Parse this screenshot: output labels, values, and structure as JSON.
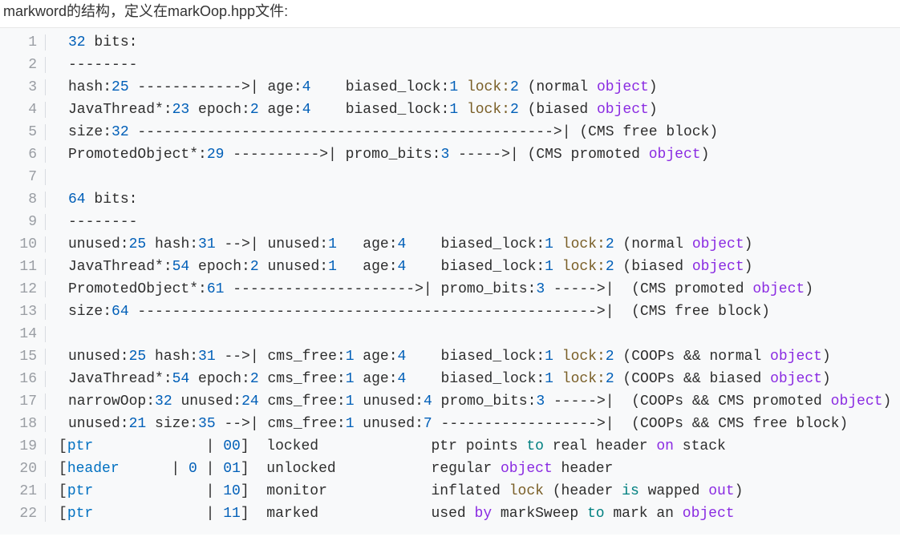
{
  "heading": "markword的结构，定义在markOop.hpp文件:",
  "lines": [
    {
      "n": 1,
      "tokens": [
        [
          "num",
          "32"
        ],
        [
          "plain",
          " bits:"
        ]
      ]
    },
    {
      "n": 2,
      "tokens": [
        [
          "plain",
          "--------"
        ]
      ]
    },
    {
      "n": 3,
      "tokens": [
        [
          "plain",
          "hash:"
        ],
        [
          "num",
          "25"
        ],
        [
          "plain",
          " ------------>| age:"
        ],
        [
          "num",
          "4"
        ],
        [
          "plain",
          "    biased_lock:"
        ],
        [
          "num",
          "1"
        ],
        [
          "plain",
          " "
        ],
        [
          "fn",
          "lock:"
        ],
        [
          "num",
          "2"
        ],
        [
          "plain",
          " (normal "
        ],
        [
          "kw",
          "object"
        ],
        [
          "plain",
          ")"
        ]
      ]
    },
    {
      "n": 4,
      "tokens": [
        [
          "plain",
          "JavaThread*:"
        ],
        [
          "num",
          "23"
        ],
        [
          "plain",
          " epoch:"
        ],
        [
          "num",
          "2"
        ],
        [
          "plain",
          " age:"
        ],
        [
          "num",
          "4"
        ],
        [
          "plain",
          "    biased_lock:"
        ],
        [
          "num",
          "1"
        ],
        [
          "plain",
          " "
        ],
        [
          "fn",
          "lock:"
        ],
        [
          "num",
          "2"
        ],
        [
          "plain",
          " (biased "
        ],
        [
          "kw",
          "object"
        ],
        [
          "plain",
          ")"
        ]
      ]
    },
    {
      "n": 5,
      "tokens": [
        [
          "plain",
          "size:"
        ],
        [
          "num",
          "32"
        ],
        [
          "plain",
          " ------------------------------------------------>| (CMS free block)"
        ]
      ]
    },
    {
      "n": 6,
      "tokens": [
        [
          "plain",
          "PromotedObject*:"
        ],
        [
          "num",
          "29"
        ],
        [
          "plain",
          " ---------->| promo_bits:"
        ],
        [
          "num",
          "3"
        ],
        [
          "plain",
          " ----->| (CMS promoted "
        ],
        [
          "kw",
          "object"
        ],
        [
          "plain",
          ")"
        ]
      ]
    },
    {
      "n": 7,
      "tokens": []
    },
    {
      "n": 8,
      "tokens": [
        [
          "num",
          "64"
        ],
        [
          "plain",
          " bits:"
        ]
      ]
    },
    {
      "n": 9,
      "tokens": [
        [
          "plain",
          "--------"
        ]
      ]
    },
    {
      "n": 10,
      "tokens": [
        [
          "plain",
          "unused:"
        ],
        [
          "num",
          "25"
        ],
        [
          "plain",
          " hash:"
        ],
        [
          "num",
          "31"
        ],
        [
          "plain",
          " -->| unused:"
        ],
        [
          "num",
          "1"
        ],
        [
          "plain",
          "   age:"
        ],
        [
          "num",
          "4"
        ],
        [
          "plain",
          "    biased_lock:"
        ],
        [
          "num",
          "1"
        ],
        [
          "plain",
          " "
        ],
        [
          "fn",
          "lock:"
        ],
        [
          "num",
          "2"
        ],
        [
          "plain",
          " (normal "
        ],
        [
          "kw",
          "object"
        ],
        [
          "plain",
          ")"
        ]
      ]
    },
    {
      "n": 11,
      "tokens": [
        [
          "plain",
          "JavaThread*:"
        ],
        [
          "num",
          "54"
        ],
        [
          "plain",
          " epoch:"
        ],
        [
          "num",
          "2"
        ],
        [
          "plain",
          " unused:"
        ],
        [
          "num",
          "1"
        ],
        [
          "plain",
          "   age:"
        ],
        [
          "num",
          "4"
        ],
        [
          "plain",
          "    biased_lock:"
        ],
        [
          "num",
          "1"
        ],
        [
          "plain",
          " "
        ],
        [
          "fn",
          "lock:"
        ],
        [
          "num",
          "2"
        ],
        [
          "plain",
          " (biased "
        ],
        [
          "kw",
          "object"
        ],
        [
          "plain",
          ")"
        ]
      ]
    },
    {
      "n": 12,
      "tokens": [
        [
          "plain",
          "PromotedObject*:"
        ],
        [
          "num",
          "61"
        ],
        [
          "plain",
          " --------------------->| promo_bits:"
        ],
        [
          "num",
          "3"
        ],
        [
          "plain",
          " ----->|  (CMS promoted "
        ],
        [
          "kw",
          "object"
        ],
        [
          "plain",
          ")"
        ]
      ]
    },
    {
      "n": 13,
      "tokens": [
        [
          "plain",
          "size:"
        ],
        [
          "num",
          "64"
        ],
        [
          "plain",
          " ----------------------------------------------------->|  (CMS free block)"
        ]
      ]
    },
    {
      "n": 14,
      "tokens": []
    },
    {
      "n": 15,
      "tokens": [
        [
          "plain",
          "unused:"
        ],
        [
          "num",
          "25"
        ],
        [
          "plain",
          " hash:"
        ],
        [
          "num",
          "31"
        ],
        [
          "plain",
          " -->| cms_free:"
        ],
        [
          "num",
          "1"
        ],
        [
          "plain",
          " age:"
        ],
        [
          "num",
          "4"
        ],
        [
          "plain",
          "    biased_lock:"
        ],
        [
          "num",
          "1"
        ],
        [
          "plain",
          " "
        ],
        [
          "fn",
          "lock:"
        ],
        [
          "num",
          "2"
        ],
        [
          "plain",
          " (COOPs && normal "
        ],
        [
          "kw",
          "object"
        ],
        [
          "plain",
          ")"
        ]
      ]
    },
    {
      "n": 16,
      "tokens": [
        [
          "plain",
          "JavaThread*:"
        ],
        [
          "num",
          "54"
        ],
        [
          "plain",
          " epoch:"
        ],
        [
          "num",
          "2"
        ],
        [
          "plain",
          " cms_free:"
        ],
        [
          "num",
          "1"
        ],
        [
          "plain",
          " age:"
        ],
        [
          "num",
          "4"
        ],
        [
          "plain",
          "    biased_lock:"
        ],
        [
          "num",
          "1"
        ],
        [
          "plain",
          " "
        ],
        [
          "fn",
          "lock:"
        ],
        [
          "num",
          "2"
        ],
        [
          "plain",
          " (COOPs && biased "
        ],
        [
          "kw",
          "object"
        ],
        [
          "plain",
          ")"
        ]
      ]
    },
    {
      "n": 17,
      "tokens": [
        [
          "plain",
          "narrowOop:"
        ],
        [
          "num",
          "32"
        ],
        [
          "plain",
          " unused:"
        ],
        [
          "num",
          "24"
        ],
        [
          "plain",
          " cms_free:"
        ],
        [
          "num",
          "1"
        ],
        [
          "plain",
          " unused:"
        ],
        [
          "num",
          "4"
        ],
        [
          "plain",
          " promo_bits:"
        ],
        [
          "num",
          "3"
        ],
        [
          "plain",
          " ----->|  (COOPs && CMS promoted "
        ],
        [
          "kw",
          "object"
        ],
        [
          "plain",
          ")"
        ]
      ]
    },
    {
      "n": 18,
      "tokens": [
        [
          "plain",
          "unused:"
        ],
        [
          "num",
          "21"
        ],
        [
          "plain",
          " size:"
        ],
        [
          "num",
          "35"
        ],
        [
          "plain",
          " -->| cms_free:"
        ],
        [
          "num",
          "1"
        ],
        [
          "plain",
          " unused:"
        ],
        [
          "num",
          "7"
        ],
        [
          "plain",
          " ------------------>|  (COOPs && CMS free block)"
        ]
      ]
    },
    {
      "n": 19,
      "indent": -1,
      "tokens": [
        [
          "plain",
          "["
        ],
        [
          "blue2",
          "ptr"
        ],
        [
          "plain",
          "             | "
        ],
        [
          "num",
          "00"
        ],
        [
          "plain",
          "]  locked             ptr points "
        ],
        [
          "teal",
          "to"
        ],
        [
          "plain",
          " real header "
        ],
        [
          "kw",
          "on"
        ],
        [
          "plain",
          " stack"
        ]
      ]
    },
    {
      "n": 20,
      "indent": -1,
      "tokens": [
        [
          "plain",
          "["
        ],
        [
          "blue2",
          "header"
        ],
        [
          "plain",
          "      | "
        ],
        [
          "num",
          "0"
        ],
        [
          "plain",
          " | "
        ],
        [
          "num",
          "01"
        ],
        [
          "plain",
          "]  unlocked           regular "
        ],
        [
          "kw",
          "object"
        ],
        [
          "plain",
          " header"
        ]
      ]
    },
    {
      "n": 21,
      "indent": -1,
      "tokens": [
        [
          "plain",
          "["
        ],
        [
          "blue2",
          "ptr"
        ],
        [
          "plain",
          "             | "
        ],
        [
          "num",
          "10"
        ],
        [
          "plain",
          "]  monitor            inflated "
        ],
        [
          "fn",
          "lock"
        ],
        [
          "plain",
          " (header "
        ],
        [
          "teal",
          "is"
        ],
        [
          "plain",
          " wapped "
        ],
        [
          "kw",
          "out"
        ],
        [
          "plain",
          ")"
        ]
      ]
    },
    {
      "n": 22,
      "indent": -1,
      "tokens": [
        [
          "plain",
          "["
        ],
        [
          "blue2",
          "ptr"
        ],
        [
          "plain",
          "             | "
        ],
        [
          "num",
          "11"
        ],
        [
          "plain",
          "]  marked             used "
        ],
        [
          "kw",
          "by"
        ],
        [
          "plain",
          " markSweep "
        ],
        [
          "teal",
          "to"
        ],
        [
          "plain",
          " mark an "
        ],
        [
          "kw",
          "object"
        ]
      ]
    }
  ]
}
